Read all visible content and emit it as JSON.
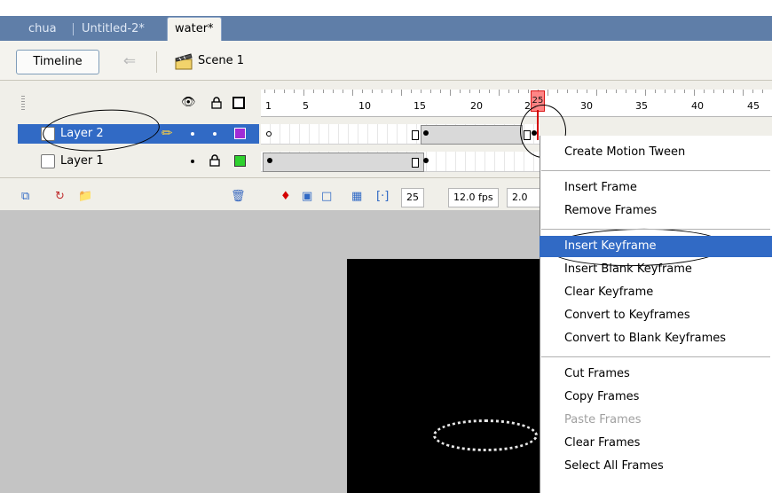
{
  "tabs": [
    {
      "label": "chua",
      "active": false
    },
    {
      "label": "Untitled-2*",
      "active": false
    },
    {
      "label": "water*",
      "active": true
    }
  ],
  "editbar": {
    "timeline_button": "Timeline",
    "scene_label": "Scene 1",
    "icons": [
      "back-arrow-icon",
      "scene-clapper-icon"
    ]
  },
  "timeline": {
    "header_icons": [
      "eye-icon",
      "lock-icon",
      "outline-icon"
    ],
    "ruler_labels": [
      "1",
      "5",
      "10",
      "15",
      "20",
      "25",
      "30",
      "35",
      "40",
      "45"
    ],
    "current_frame": "25",
    "frame_rate": "12.0 fps",
    "elapsed": "2.0",
    "layers": [
      {
        "name": "Layer 2",
        "selected": true,
        "outline_color": "#a02cd6"
      },
      {
        "name": "Layer 1",
        "selected": false,
        "outline_color": "#2fd12f"
      }
    ]
  },
  "context_menu": {
    "groups": [
      [
        {
          "label": "Create Motion Tween",
          "state": "normal"
        }
      ],
      [
        {
          "label": "Insert Frame",
          "state": "normal"
        },
        {
          "label": "Remove Frames",
          "state": "normal"
        }
      ],
      [
        {
          "label": "Insert Keyframe",
          "state": "selected"
        },
        {
          "label": "Insert Blank Keyframe",
          "state": "normal"
        },
        {
          "label": "Clear Keyframe",
          "state": "normal"
        },
        {
          "label": "Convert to Keyframes",
          "state": "normal"
        },
        {
          "label": "Convert to Blank Keyframes",
          "state": "normal"
        }
      ],
      [
        {
          "label": "Cut Frames",
          "state": "normal"
        },
        {
          "label": "Copy Frames",
          "state": "normal"
        },
        {
          "label": "Paste Frames",
          "state": "disabled"
        },
        {
          "label": "Clear Frames",
          "state": "normal"
        },
        {
          "label": "Select All Frames",
          "state": "normal"
        }
      ]
    ]
  },
  "colors": {
    "tabbar": "#5f7ea8",
    "selection": "#316ac5",
    "playhead": "#d40000",
    "stage": "#000000"
  }
}
